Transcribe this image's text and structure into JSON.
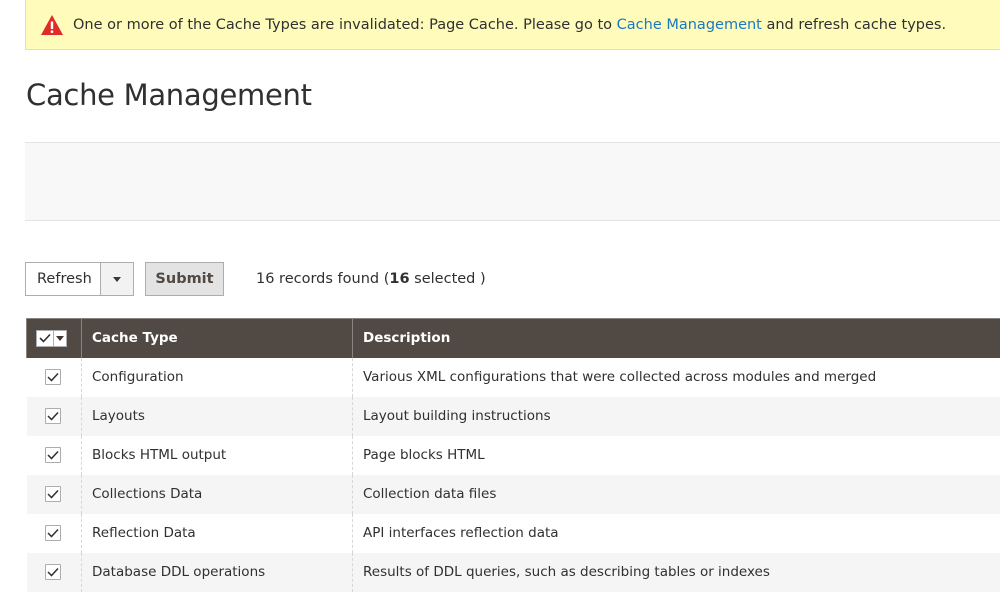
{
  "notice": {
    "prefix": "One or more of the Cache Types are invalidated: Page Cache. Please go to ",
    "link": "Cache Management",
    "suffix": " and refresh cache types."
  },
  "page_title": "Cache Management",
  "massaction": {
    "selected_action": "Refresh",
    "submit_label": "Submit",
    "records_prefix": "16 records found (",
    "selected_count": "16",
    "records_suffix": " selected )"
  },
  "table": {
    "headers": {
      "cache_type": "Cache Type",
      "description": "Description"
    },
    "rows": [
      {
        "cache_type": "Configuration",
        "description": "Various XML configurations that were collected across modules and merged"
      },
      {
        "cache_type": "Layouts",
        "description": "Layout building instructions"
      },
      {
        "cache_type": "Blocks HTML output",
        "description": "Page blocks HTML"
      },
      {
        "cache_type": "Collections Data",
        "description": "Collection data files"
      },
      {
        "cache_type": "Reflection Data",
        "description": "API interfaces reflection data"
      },
      {
        "cache_type": "Database DDL operations",
        "description": "Results of DDL queries, such as describing tables or indexes"
      }
    ]
  },
  "colors": {
    "notice_bg": "#fffbbb",
    "warning": "#e22626",
    "link": "#1979c3",
    "header_bg": "#514943"
  },
  "icons": {
    "warning": "warning-triangle-icon",
    "check": "checkmark-icon",
    "dropdown": "chevron-down-icon"
  }
}
